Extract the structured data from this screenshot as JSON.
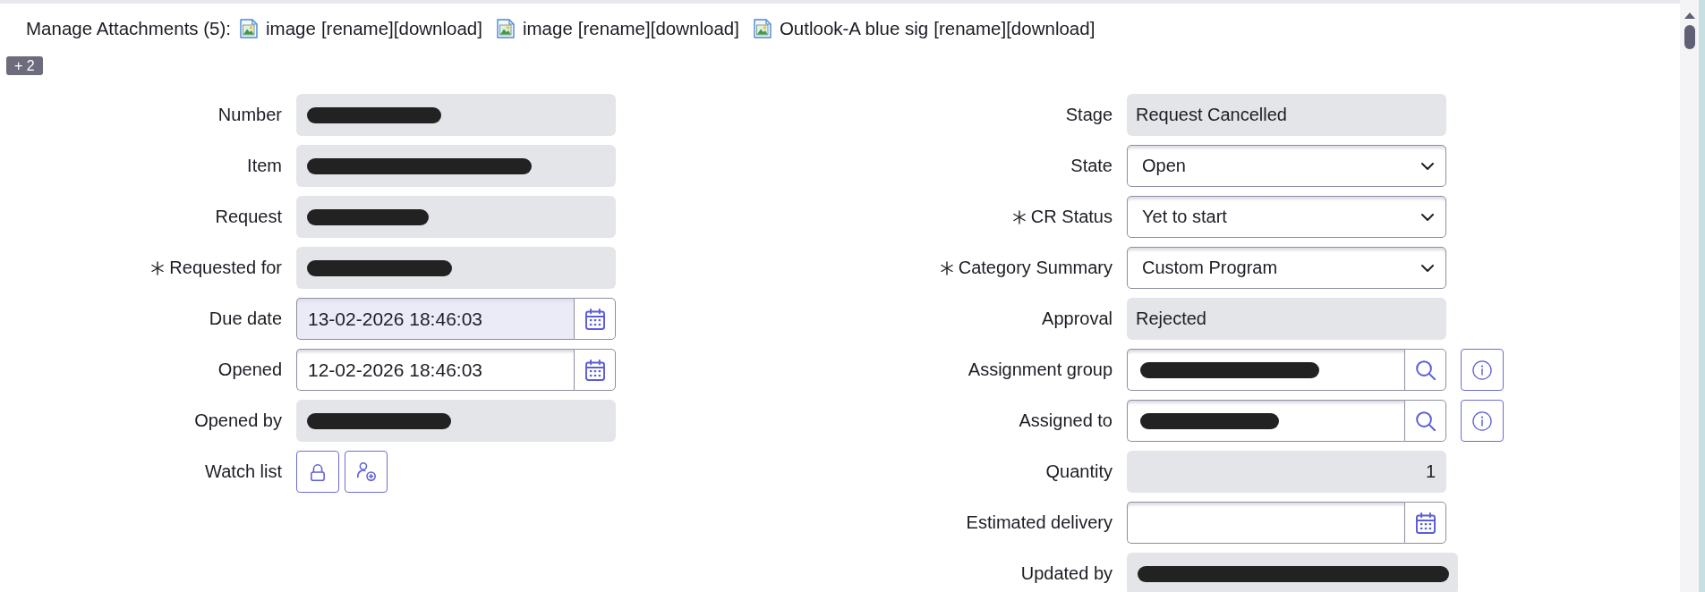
{
  "attachments": {
    "label": "Manage Attachments (5):",
    "items": [
      {
        "name": "image",
        "actions": [
          "[rename]",
          "[download]"
        ]
      },
      {
        "name": "image",
        "actions": [
          "[rename]",
          "[download]"
        ]
      },
      {
        "name": "Outlook-A blue sig",
        "actions": [
          "[rename]",
          "[download]"
        ]
      }
    ],
    "more": "+ 2"
  },
  "form": {
    "left": [
      {
        "label": "Number",
        "kind": "readonly",
        "mandatory": false,
        "redacted": true
      },
      {
        "label": "Item",
        "kind": "readonly",
        "mandatory": false,
        "redacted": true
      },
      {
        "label": "Request",
        "kind": "readonly",
        "mandatory": false,
        "redacted": true
      },
      {
        "label": "Requested for",
        "kind": "readonly",
        "mandatory": true,
        "redacted": true
      },
      {
        "label": "Due date",
        "kind": "date",
        "value": "13-02-2026 18:46:03",
        "mandatory": false,
        "focused": true
      },
      {
        "label": "Opened",
        "kind": "date",
        "value": "12-02-2026 18:46:03",
        "mandatory": false,
        "focused": false
      },
      {
        "label": "Opened by",
        "kind": "readonly",
        "mandatory": false,
        "redacted": true
      },
      {
        "label": "Watch list",
        "kind": "watchlist",
        "mandatory": false
      }
    ],
    "right": [
      {
        "label": "Stage",
        "kind": "readonly",
        "value": "Request Cancelled",
        "mandatory": false
      },
      {
        "label": "State",
        "kind": "select",
        "value": "Open",
        "mandatory": false
      },
      {
        "label": "CR Status",
        "kind": "select",
        "value": "Yet to start",
        "mandatory": true
      },
      {
        "label": "Category Summary",
        "kind": "select",
        "value": "Custom Program",
        "mandatory": true
      },
      {
        "label": "Approval",
        "kind": "readonly",
        "value": "Rejected",
        "mandatory": false
      },
      {
        "label": "Assignment group",
        "kind": "reference",
        "mandatory": false,
        "redacted": true
      },
      {
        "label": "Assigned to",
        "kind": "reference",
        "mandatory": false,
        "redacted": true
      },
      {
        "label": "Quantity",
        "kind": "numeric",
        "value": "1",
        "mandatory": false
      },
      {
        "label": "Estimated delivery",
        "kind": "date",
        "mandatory": false,
        "focused": false
      },
      {
        "label": "Updated by",
        "kind": "readonly",
        "mandatory": false,
        "redacted": true
      }
    ]
  }
}
